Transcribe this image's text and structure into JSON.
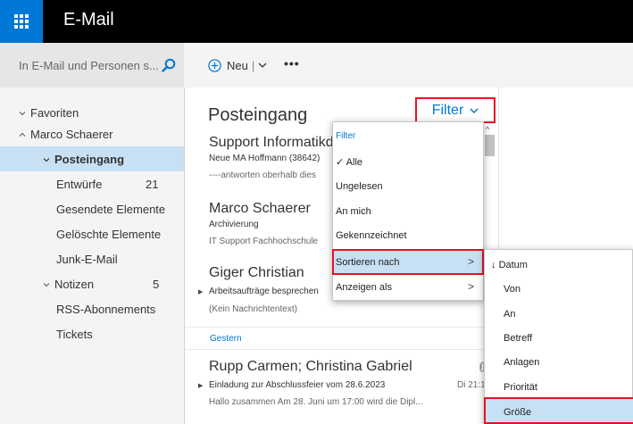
{
  "app": {
    "title": "E-Mail"
  },
  "search": {
    "placeholder": "In E-Mail und Personen s..."
  },
  "toolbar": {
    "new_label": "Neu",
    "separator": "|",
    "more": "•••"
  },
  "nav": {
    "favorites": "Favoriten",
    "account": "Marco Schaerer",
    "inbox": "Posteingang",
    "drafts": "Entwürfe",
    "drafts_count": "21",
    "sent": "Gesendete Elemente",
    "deleted": "Gelöschte Elemente",
    "junk": "Junk-E-Mail",
    "notes": "Notizen",
    "notes_count": "5",
    "rss": "RSS-Abonnements",
    "tickets": "Tickets"
  },
  "list": {
    "title": "Posteingang",
    "filter_label": "Filter",
    "messages": [
      {
        "sender": "Support Informatikd",
        "subject": "Neue MA Hoffmann (38642)",
        "preview": "----antworten oberhalb dies"
      },
      {
        "sender": "Marco Schaerer",
        "subject": "Archivierung",
        "preview": "IT Support  Fachhochschule"
      },
      {
        "sender": "Giger Christian",
        "subject": "Arbeitsaufträge besprechen",
        "preview": "(Kein Nachrichtentext)"
      }
    ],
    "group_yesterday": "Gestern",
    "message_4": {
      "sender": "Rupp Carmen; Christina Gabriel",
      "subject": "Einladung zur Abschlussfeier vom 28.6.2023",
      "time": "Di 21:18",
      "preview": "Hallo zusammen  Am 28. Juni um 17:00 wird die Dipl..."
    }
  },
  "filter_menu": {
    "header": "Filter",
    "items": [
      "Alle",
      "Ungelesen",
      "An mich",
      "Gekennzeichnet",
      "Sortieren nach",
      "Anzeigen als"
    ],
    "checked": "Alle",
    "arrow": ">"
  },
  "sort_menu": {
    "items": [
      "Datum",
      "Von",
      "An",
      "Betreff",
      "Anlagen",
      "Priorität",
      "Größe"
    ],
    "checked_symbol": "↓",
    "selected": "Größe"
  },
  "colors": {
    "accent": "#0078d7",
    "highlight": "#c7e0f4",
    "callout": "#e81123"
  }
}
